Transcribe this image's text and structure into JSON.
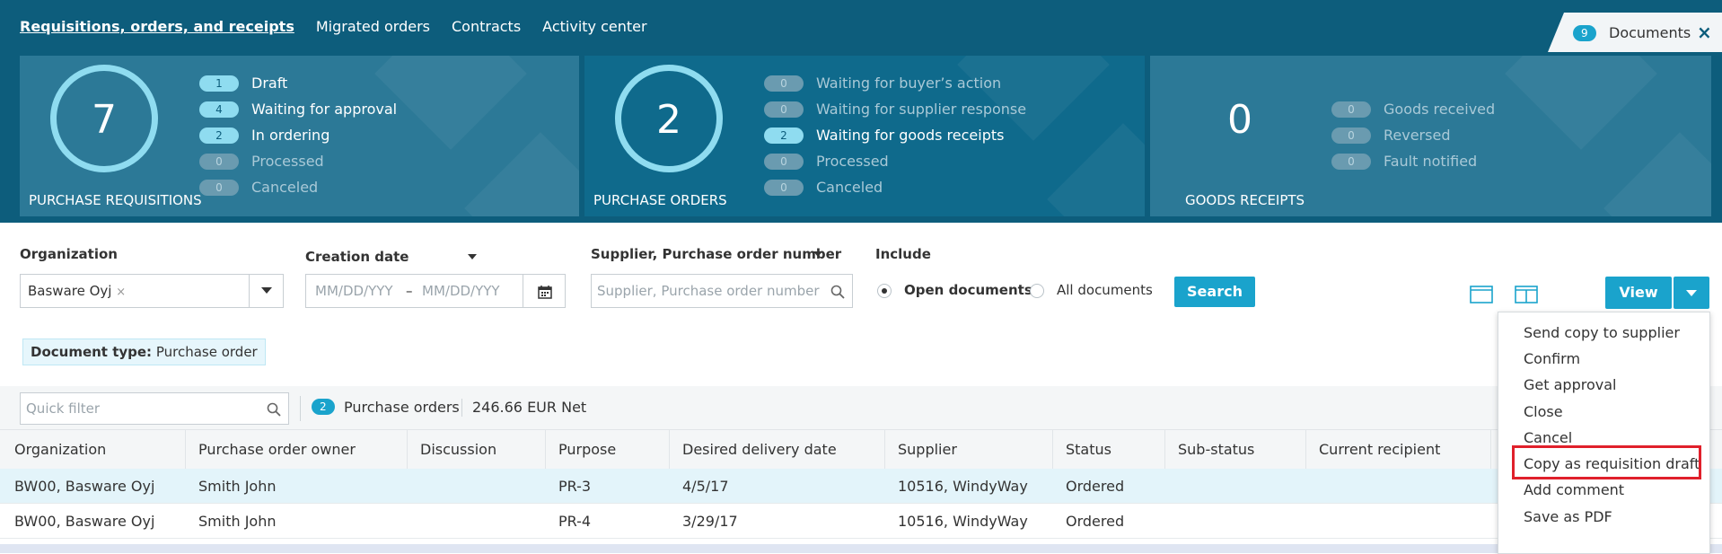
{
  "topnav": {
    "items": [
      "Requisitions, orders, and receipts",
      "Migrated orders",
      "Contracts",
      "Activity center"
    ],
    "documents_count": "9",
    "documents_label": "Documents",
    "close_glyph": "×"
  },
  "cards": {
    "pr": {
      "count": "7",
      "title": "PURCHASE REQUISITIONS",
      "statuses": [
        {
          "n": "1",
          "label": "Draft"
        },
        {
          "n": "4",
          "label": "Waiting for approval"
        },
        {
          "n": "2",
          "label": "In ordering"
        },
        {
          "n": "0",
          "label": "Processed"
        },
        {
          "n": "0",
          "label": "Canceled"
        }
      ]
    },
    "po": {
      "count": "2",
      "title": "PURCHASE ORDERS",
      "statuses": [
        {
          "n": "0",
          "label": "Waiting for buyer’s action"
        },
        {
          "n": "0",
          "label": "Waiting for supplier response"
        },
        {
          "n": "2",
          "label": "Waiting for goods receipts"
        },
        {
          "n": "0",
          "label": "Processed"
        },
        {
          "n": "0",
          "label": "Canceled"
        }
      ]
    },
    "gr": {
      "count": "0",
      "title": "GOODS RECEIPTS",
      "statuses": [
        {
          "n": "0",
          "label": "Goods received"
        },
        {
          "n": "0",
          "label": "Reversed"
        },
        {
          "n": "0",
          "label": "Fault notified"
        }
      ]
    }
  },
  "filters": {
    "organization_label": "Organization",
    "organization_value": "Basware Oyj",
    "organization_remove": "×",
    "creation_date_label": "Creation date",
    "date_from_placeholder": "MM/DD/YYY",
    "date_sep": "–",
    "date_to_placeholder": "MM/DD/YYY",
    "supplier_label": "Supplier, Purchase order number",
    "supplier_placeholder": "Supplier, Purchase order number",
    "include_label": "Include",
    "open_documents": "Open documents",
    "all_documents": "All documents",
    "search_button": "Search",
    "view_button": "View"
  },
  "doctype": {
    "key": "Document type:",
    "value": "Purchase order"
  },
  "listbar": {
    "quick_filter_placeholder": "Quick filter",
    "count": "2",
    "count_label": "Purchase orders",
    "net": "246.66 EUR Net"
  },
  "table": {
    "headers": [
      "Organization",
      "Purchase order owner",
      "Discussion",
      "Purpose",
      "Desired delivery date",
      "Supplier",
      "Status",
      "Sub-status",
      "Current recipient"
    ],
    "rows": [
      [
        "BW00, Basware Oyj",
        "Smith John",
        "",
        "PR-3",
        "4/5/17",
        "10516, WindyWay",
        "Ordered",
        "",
        ""
      ],
      [
        "BW00, Basware Oyj",
        "Smith John",
        "",
        "PR-4",
        "3/29/17",
        "10516, WindyWay",
        "Ordered",
        "",
        ""
      ]
    ]
  },
  "view_menu": {
    "items": [
      "Send copy to supplier",
      "Confirm",
      "Get approval",
      "Close",
      "Cancel",
      "Copy as requisition draft",
      "Add comment",
      "Save as PDF"
    ],
    "highlighted": "Copy as requisition draft"
  },
  "colors": {
    "brand": "#0d5d7c",
    "accent": "#1aa3cc",
    "highlight": "#e0202b"
  }
}
